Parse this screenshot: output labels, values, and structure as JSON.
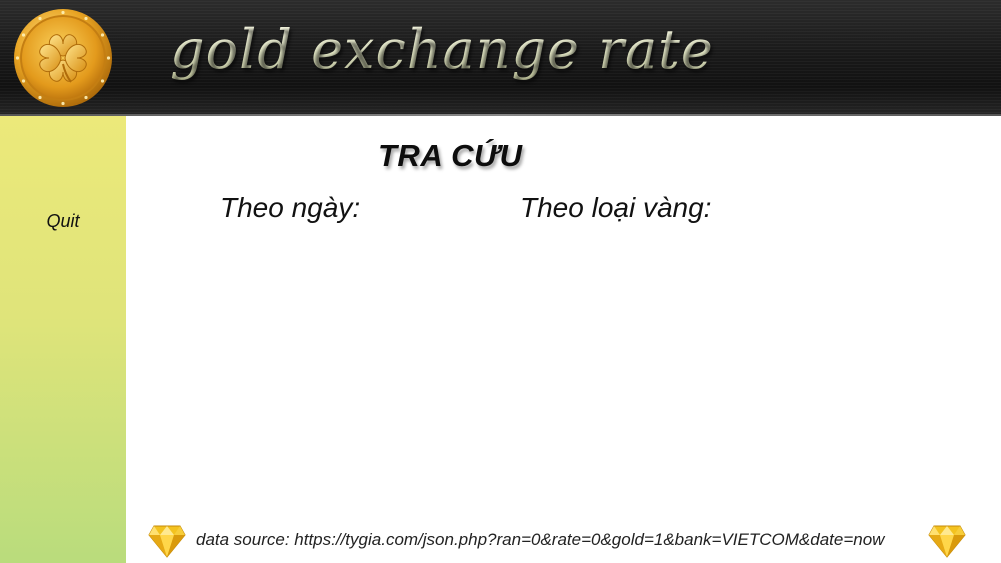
{
  "header": {
    "app_title": "gold exchange rate",
    "logo_icon": "gold-clover-coin-icon"
  },
  "sidebar": {
    "quit_label": "Quit"
  },
  "main": {
    "section_title": "TRA CỨU",
    "filters": {
      "by_date_label": "Theo ngày:",
      "by_gold_type_label": "Theo loại vàng:"
    },
    "footer": {
      "source_text": "data source: https://tygia.com/json.php?ran=0&rate=0&gold=1&bank=VIETCOM&date=now",
      "left_icon": "diamond-icon",
      "right_icon": "diamond-icon"
    }
  },
  "colors": {
    "header_dark": "#1a1a1a",
    "sidebar_top": "#ece97a",
    "sidebar_bottom": "#b9dc7c",
    "gold": "#e7a21c",
    "title_text": "#e9ecd0"
  }
}
